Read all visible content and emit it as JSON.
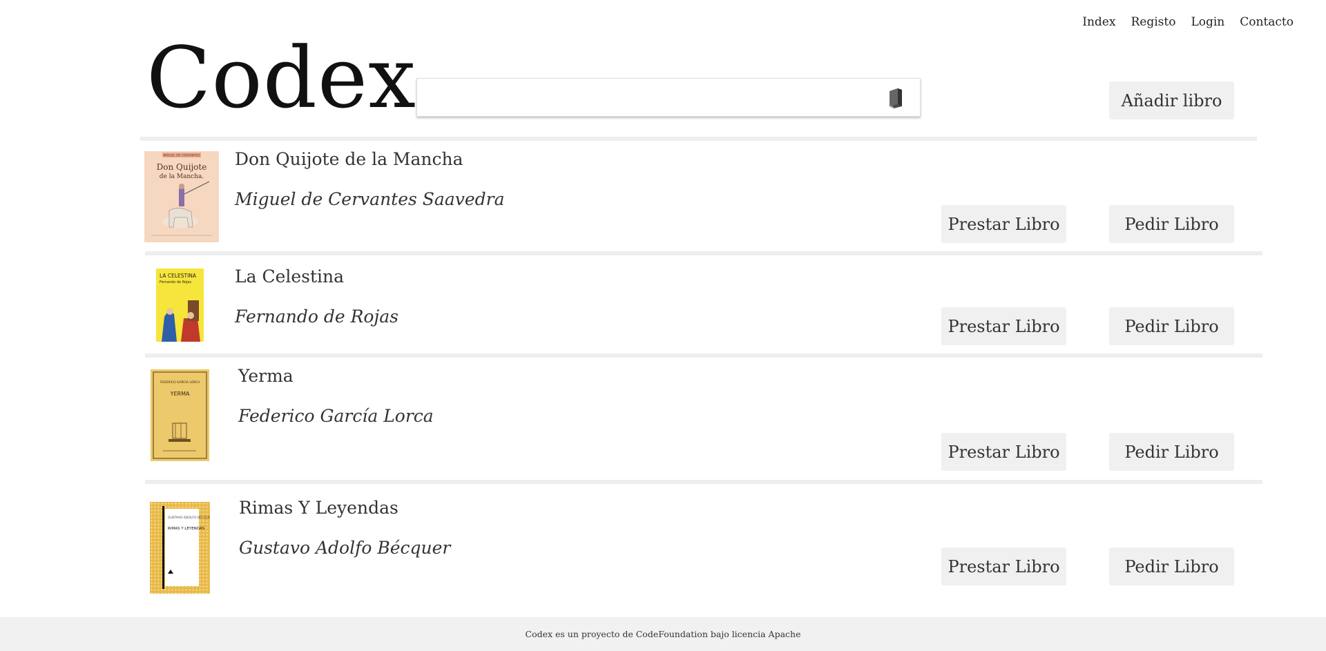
{
  "nav": {
    "items": [
      {
        "label": "Index"
      },
      {
        "label": "Registo"
      },
      {
        "label": "Login"
      },
      {
        "label": "Contacto"
      }
    ]
  },
  "header": {
    "logo": "Codex",
    "search": {
      "value": "",
      "placeholder": "",
      "icon": "book-icon"
    },
    "add_button": "Añadir libro"
  },
  "books": [
    {
      "title": "Don Quijote de la Mancha",
      "author": "Miguel de Cervantes Saavedra",
      "cover_text": "Don Quijote de la Mancha.",
      "cover_top": "MIGUEL DE CERVANTES",
      "lend": "Prestar Libro",
      "ask": "Pedir Libro"
    },
    {
      "title": "La Celestina",
      "author": "Fernando de Rojas",
      "cover_text": "LA CELESTINA",
      "cover_top": "Fernando de Rojas",
      "lend": "Prestar Libro",
      "ask": "Pedir Libro"
    },
    {
      "title": "Yerma",
      "author": "Federico García Lorca",
      "cover_text": "YERMA",
      "cover_top": "FEDERICO GARCIA LORCA",
      "lend": "Prestar Libro",
      "ask": "Pedir Libro"
    },
    {
      "title": "Rimas Y Leyendas",
      "author": "Gustavo Adolfo Bécquer",
      "cover_text": "RIMAS Y LEYENDAS",
      "cover_top": "GUSTAVO ADOLFO BÉCQUER",
      "lend": "Prestar Libro",
      "ask": "Pedir Libro"
    }
  ],
  "footer": {
    "text": "Codex es un proyecto de CodeFoundation bajo licencia Apache"
  },
  "colors": {
    "button_bg": "#f0f0f0",
    "divider": "#eeeeee",
    "footer_bg": "#f1f1f1"
  }
}
